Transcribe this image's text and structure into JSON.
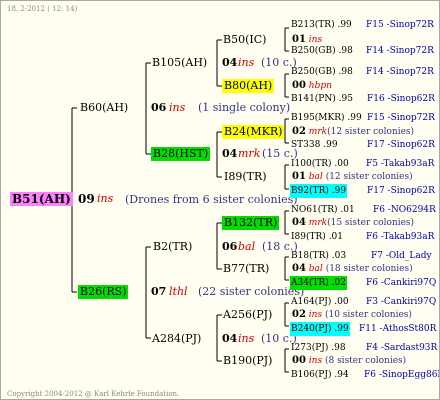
{
  "header": {
    "stamp": "18.  2-2012 ( 12: 14)"
  },
  "footer": {
    "copyright": "Copyright 2004-2012 @ Karl Kehrle Foundation."
  },
  "root": {
    "name": "B51(AH)",
    "num": "09",
    "mark": "ins",
    "note": "(Drones from 6 sister colonies)"
  },
  "gen1": [
    {
      "name": "B60(AH)",
      "num": "06",
      "mark": "ins",
      "note": "(1 single colony)"
    },
    {
      "name": "B26(RS)",
      "num": "07",
      "mark": "lthl",
      "note": "(22 sister colonies)"
    }
  ],
  "gen2": [
    {
      "name": "B105(AH)",
      "num": "04",
      "mark": "ins",
      "note": "(10 c.)"
    },
    {
      "name": "B28(HST)",
      "num": "04",
      "mark": "mrk",
      "note": "(15 c.)"
    },
    {
      "name": "B2(TR)",
      "num": "06",
      "mark": "bal",
      "note": "(18 c.)"
    },
    {
      "name": "A284(PJ)",
      "num": "04",
      "mark": "ins",
      "note": "(10 c.)"
    }
  ],
  "gen3": [
    {
      "name": "B50(IC)",
      "num": "01",
      "mark": "ins",
      "note": ""
    },
    {
      "name": "B80(AH)",
      "num": "00",
      "mark": "hbpn",
      "note": ""
    },
    {
      "name": "B24(MKR)",
      "num": "02",
      "mark": "mrk",
      "note": "(12 sister colonies)"
    },
    {
      "name": "I89(TR)",
      "num": "01",
      "mark": "bal",
      "note": "(12 sister colonies)"
    },
    {
      "name": "B132(TR)",
      "num": "04",
      "mark": "mrk",
      "note": "(15 sister colonies)"
    },
    {
      "name": "B77(TR)",
      "num": "04",
      "mark": "bal",
      "note": "(18 sister colonies)"
    },
    {
      "name": "A256(PJ)",
      "num": "02",
      "mark": "ins",
      "note": "(10 sister colonies)"
    },
    {
      "name": "B190(PJ)",
      "num": "00",
      "mark": "ins",
      "note": "(8 sister colonies)"
    }
  ],
  "gen4": [
    {
      "name": "B213(TR)",
      "val": ".99",
      "ref": "F15 -Sinop72R"
    },
    {
      "name": "B250(GB)",
      "val": ".98",
      "ref": "F14 -Sinop72R"
    },
    {
      "name": "B250(GB)",
      "val": ".98",
      "ref": "F14 -Sinop72R"
    },
    {
      "name": "B141(PN)",
      "val": ".95",
      "ref": "F16 -Sinop62R"
    },
    {
      "name": "B195(MKR)",
      "val": ".99",
      "ref": "F15 -Sinop72R"
    },
    {
      "name": "ST338",
      "val": ".99",
      "ref": "F17 -Sinop62R"
    },
    {
      "name": "I100(TR)",
      "val": ".00",
      "ref": "F5 -Takab93aR"
    },
    {
      "name": "B92(TR)",
      "val": ".99",
      "ref": "F17 -Sinop62R"
    },
    {
      "name": "NO61(TR)",
      "val": ".01",
      "ref": "F6 -NO6294R"
    },
    {
      "name": "I89(TR)",
      "val": ".01",
      "ref": "F6 -Takab93aR"
    },
    {
      "name": "B18(TR)",
      "val": ".03",
      "ref": "F7 -Old_Lady"
    },
    {
      "name": "A34(TR)",
      "val": ".02",
      "ref": "F6 -Cankiri97Q"
    },
    {
      "name": "A164(PJ)",
      "val": ".00",
      "ref": "F3 -Cankiri97Q"
    },
    {
      "name": "B240(PJ)",
      "val": ".99",
      "ref": "F11 -AthosSt80R"
    },
    {
      "name": "I273(PJ)",
      "val": ".98",
      "ref": "F4 -Sardast93R"
    },
    {
      "name": "B106(PJ)",
      "val": ".94",
      "ref": "F6 -SinopEgg86R"
    }
  ]
}
